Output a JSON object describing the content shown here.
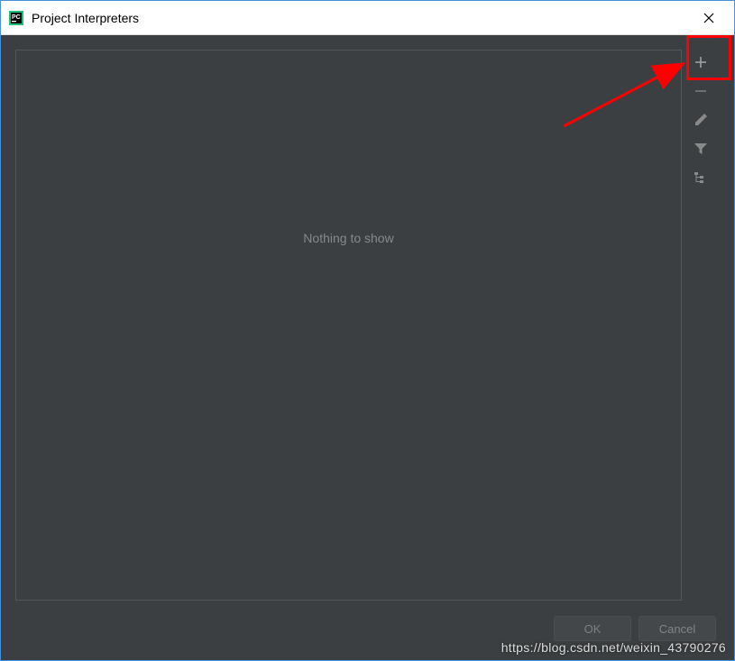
{
  "window": {
    "title": "Project Interpreters"
  },
  "main": {
    "empty_text": "Nothing to show"
  },
  "toolbar": {
    "add_label": "Add",
    "remove_label": "Remove",
    "edit_label": "Edit",
    "filter_label": "Filter",
    "tree_label": "Tree"
  },
  "footer": {
    "ok_label": "OK",
    "cancel_label": "Cancel"
  },
  "watermark": "https://blog.csdn.net/weixin_43790276"
}
